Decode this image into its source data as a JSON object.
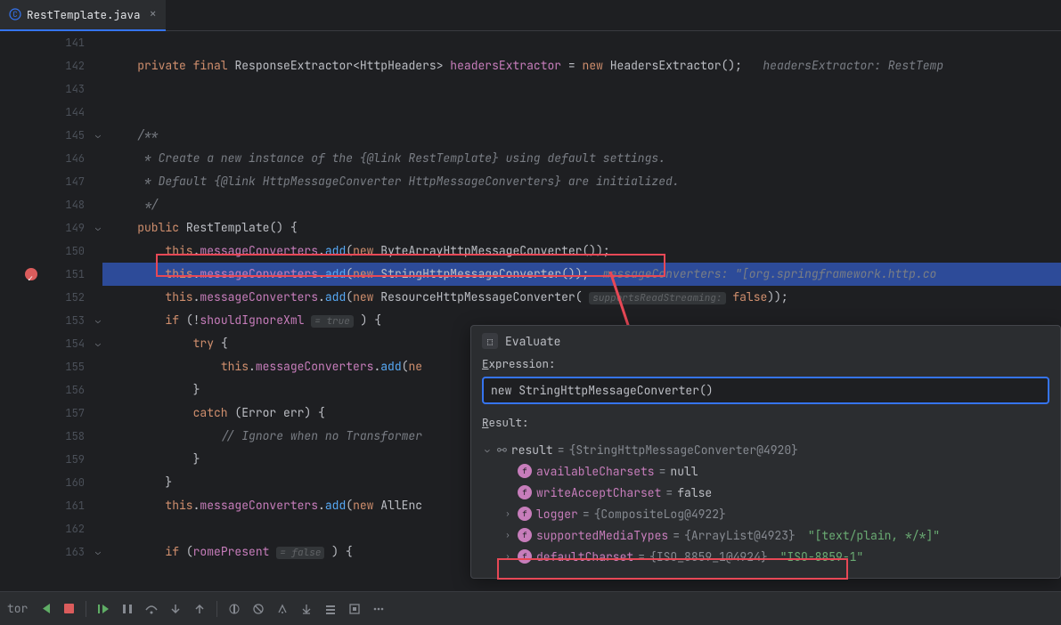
{
  "tab": {
    "name": "RestTemplate.java"
  },
  "gutter": {
    "lines": [
      "141",
      "142",
      "143",
      "144",
      "145",
      "146",
      "147",
      "148",
      "149",
      "150",
      "151",
      "152",
      "153",
      "154",
      "155",
      "156",
      "157",
      "158",
      "159",
      "160",
      "161",
      "162",
      "163"
    ],
    "breakpoint_line": 151
  },
  "code": {
    "l141": "",
    "l149_kw1": "public",
    "l149_type": "RestTemplate",
    "l150_pre": "this",
    "l150_field": "messageConverters",
    "l150_m": "add",
    "l150_new": "new",
    "l150_t": "ByteArrayHttpMessageConverter",
    "l151_pre": "this",
    "l151_field": "messageConverters",
    "l151_m": "add",
    "l151_new": "new",
    "l151_t": "StringHttpMessageConverter",
    "l151_hint": "messageConverters: \"[org.springframework.http.co",
    "l152_pre": "this",
    "l152_field": "messageConverters",
    "l152_m": "add",
    "l152_new": "new",
    "l152_t": "ResourceHttpMessageConverter",
    "l152_hint": "supportsReadStreaming:",
    "l152_bool": "false",
    "l153_if": "if",
    "l153_var": "shouldIgnoreXml",
    "l153_hint": "= true",
    "l154_try": "try",
    "l155_pre": "this",
    "l155_field": "messageConverters",
    "l155_m": "add",
    "l155_new": "ne",
    "l157_catch": "catch",
    "l157_err": "Error err",
    "l158_comment": "// Ignore when no Transformer",
    "l161_pre": "this",
    "l161_field": "messageConverters",
    "l161_m": "add",
    "l161_new": "new",
    "l161_t": "AllEnc",
    "l163_if": "if",
    "l163_var": "romePresent",
    "l163_hint": "= false",
    "l142_kw1": "private",
    "l142_kw2": "final",
    "l142_type": "ResponseExtractor",
    "l142_gen": "HttpHeaders",
    "l142_field": "headersExtractor",
    "l142_new": "new",
    "l142_t": "HeadersExtractor",
    "l142_hint": "headersExtractor: RestTemp",
    "l145": "/**",
    "l146": " * Create a new instance of the {@link RestTemplate} using default settings.",
    "l147": " * Default {@link HttpMessageConverter HttpMessageConverters} are initialized.",
    "l148": " */"
  },
  "evaluate": {
    "title": "Evaluate",
    "expr_label": "Expression:",
    "expr_value": "new StringHttpMessageConverter()",
    "result_label": "Result:",
    "result": {
      "root": {
        "name": "result",
        "cls": "{StringHttpMessageConverter@4920}"
      },
      "fields": [
        {
          "name": "availableCharsets",
          "value": "null",
          "leaf": true
        },
        {
          "name": "writeAcceptCharset",
          "value": "false",
          "leaf": true
        },
        {
          "name": "logger",
          "cls": "{CompositeLog@4922}",
          "leaf": false
        },
        {
          "name": "supportedMediaTypes",
          "cls": "{ArrayList@4923}",
          "str": "\"[text/plain, */*]\"",
          "leaf": false
        },
        {
          "name": "defaultCharset",
          "cls": "{ISO_8859_1@4924}",
          "str": "\"ISO-8859-1\"",
          "leaf": false
        }
      ]
    }
  },
  "toolbar": {
    "buttons": [
      "rerun",
      "stop",
      "resume",
      "pause",
      "step-over",
      "step-into",
      "step-out",
      "run-to-cursor",
      "evaluate",
      "trace",
      "mute",
      "view-bp",
      "thread",
      "more"
    ]
  }
}
